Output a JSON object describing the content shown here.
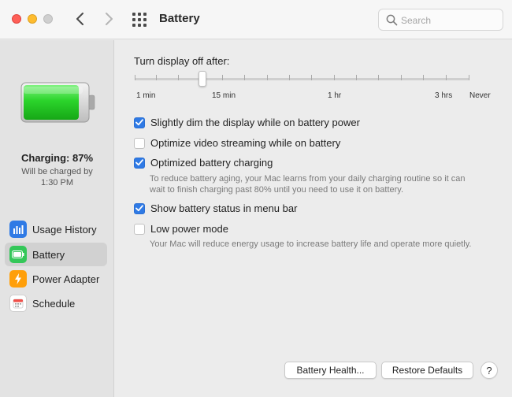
{
  "window": {
    "title": "Battery",
    "search": {
      "placeholder": "Search",
      "value": ""
    }
  },
  "sidebar": {
    "status_title": "Charging: 87%",
    "status_sub_1": "Will be charged by",
    "status_sub_2": "1:30 PM",
    "battery_level": 0.87,
    "items": [
      {
        "label": "Usage History",
        "icon": "bar-chart-icon",
        "color": "#2f7ae5"
      },
      {
        "label": "Battery",
        "icon": "battery-icon",
        "color": "#34c759",
        "selected": true
      },
      {
        "label": "Power Adapter",
        "icon": "lightning-icon",
        "color": "#ff9f0a"
      },
      {
        "label": "Schedule",
        "icon": "calendar-icon",
        "color": "#ffffff"
      }
    ]
  },
  "main": {
    "display_off_label": "Turn display off after:",
    "slider": {
      "labels": [
        "1 min",
        "15 min",
        "1 hr",
        "3 hrs",
        "Never"
      ],
      "selected": "15 min"
    },
    "options": [
      {
        "label": "Slightly dim the display while on battery power",
        "checked": true
      },
      {
        "label": "Optimize video streaming while on battery",
        "checked": false
      },
      {
        "label": "Optimized battery charging",
        "checked": true,
        "help_1": "To reduce battery aging, your Mac learns from your daily charging routine so it can",
        "help_2": "wait to finish charging past 80% until you need to use it on battery."
      },
      {
        "label": "Show battery status in menu bar",
        "checked": true
      },
      {
        "label": "Low power mode",
        "checked": false,
        "help_1": "Your Mac will reduce energy usage to increase battery life and operate more quietly."
      }
    ],
    "buttons": {
      "battery_health": "Battery Health...",
      "restore_defaults": "Restore Defaults",
      "help": "?"
    }
  },
  "colors": {
    "accent": "#2f7ae5",
    "battery_green": "#3dd13d"
  }
}
